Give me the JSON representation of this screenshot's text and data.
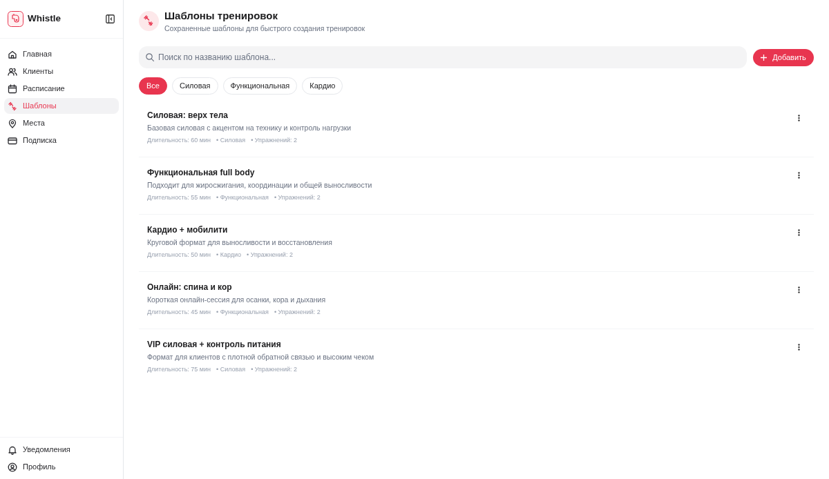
{
  "sidebar": {
    "brand": "Whistle",
    "nav": [
      {
        "label": "Главная",
        "selected": false
      },
      {
        "label": "Клиенты",
        "selected": false
      },
      {
        "label": "Расписание",
        "selected": false
      },
      {
        "label": "Шаблоны",
        "selected": true
      },
      {
        "label": "Места",
        "selected": false
      },
      {
        "label": "Подписка",
        "selected": false
      }
    ],
    "footer_nav": [
      {
        "label": "Уведомления",
        "selected": false
      },
      {
        "label": "Профиль",
        "selected": false
      }
    ]
  },
  "header": {
    "title": "Шаблоны тренировок",
    "subtitle": "Сохраненные шаблоны для быстрого создания тренировок"
  },
  "search": {
    "placeholder": "Поиск по названию шаблона..."
  },
  "add_button": {
    "label": "Добавить"
  },
  "filters": [
    {
      "label": "Все",
      "selected": true
    },
    {
      "label": "Силовая",
      "selected": false
    },
    {
      "label": "Функциональная",
      "selected": false
    },
    {
      "label": "Кардио",
      "selected": false
    }
  ],
  "templates": [
    {
      "title": "Силовая: верх тела",
      "description": "Базовая силовая с акцентом на технику и контроль нагрузки",
      "meta": [
        "Длительность: 60 мин",
        "• Силовая",
        "• Упражнений: 2"
      ]
    },
    {
      "title": "Функциональная full body",
      "description": "Подходит для жиросжигания, координации и общей выносливости",
      "meta": [
        "Длительность: 55 мин",
        "• Функциональная",
        "• Упражнений: 2"
      ]
    },
    {
      "title": "Кардио + мобилити",
      "description": "Круговой формат для выносливости и восстановления",
      "meta": [
        "Длительность: 50 мин",
        "• Кардио",
        "• Упражнений: 2"
      ]
    },
    {
      "title": "Онлайн: спина и кор",
      "description": "Короткая онлайн-сессия для осанки, кора и дыхания",
      "meta": [
        "Длительность: 45 мин",
        "• Функциональная",
        "• Упражнений: 2"
      ]
    },
    {
      "title": "VIP силовая + контроль питания",
      "description": "Формат для клиентов с плотной обратной связью и высоким чеком",
      "meta": [
        "Длительность: 75 мин",
        "• Силовая",
        "• Упражнений: 2"
      ]
    }
  ]
}
